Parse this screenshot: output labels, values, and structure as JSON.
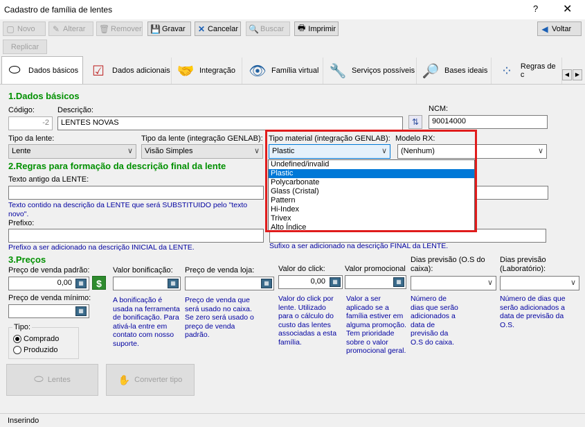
{
  "window": {
    "title": "Cadastro de família de lentes",
    "help": "?",
    "close": "✕"
  },
  "toolbar": {
    "novo": "Novo",
    "alterar": "Alterar",
    "remover": "Remover",
    "gravar": "Gravar",
    "cancelar": "Cancelar",
    "buscar": "Buscar",
    "imprimir": "Imprimir",
    "voltar": "Voltar",
    "replicar": "Replicar"
  },
  "tabs": [
    "Dados básicos",
    "Dados adicionais",
    "Integração",
    "Família virtual",
    "Serviços possíveis",
    "Bases ideais",
    "Regras de c"
  ],
  "sec1": {
    "title": "1.Dados básicos",
    "codigo_label": "Código:",
    "codigo_value": "-2",
    "descricao_label": "Descrição:",
    "descricao_value": "LENTES NOVAS",
    "ncm_label": "NCM:",
    "ncm_value": "90014000",
    "tipo_lente_label": "Tipo da lente:",
    "tipo_lente_value": "Lente",
    "tipo_lente_int_label": "Tipo da lente (integração GENLAB):",
    "tipo_lente_int_value": "Visão Simples",
    "tipo_material_label": "Tipo material (integração GENLAB):",
    "tipo_material_value": "Plastic",
    "modelo_rx_label": "Modelo RX:",
    "modelo_rx_value": "(Nenhum)",
    "material_options": [
      "Undefined/invalid",
      "Plastic",
      "Polycarbonate",
      "Glass (Cristal)",
      "Pattern",
      "Hi-Index",
      "Trivex",
      "Alto Índice"
    ],
    "material_selected_index": 1
  },
  "sec2": {
    "title": "2.Regras para formação da descrição final da lente",
    "texto_antigo_label": "Texto antigo da LENTE:",
    "texto_antigo_hint": "Texto contido na descrição da LENTE que será SUBSTITUIDO pelo \"texto novo\".",
    "prefixo_label": "Prefixo:",
    "prefixo_hint": "Prefixo a ser adicionado na descrição INICIAL da LENTE.",
    "sufixo_hint": "Sufixo a ser adicionado na descrição FINAL da LENTE."
  },
  "sec3": {
    "title": "3.Preços",
    "preco_venda_label": "Preço de venda padrão:",
    "preco_venda_value": "0,00",
    "valor_bonif_label": "Valor bonificação:",
    "valor_bonif_hint": "A bonificação é usada na ferramenta de bonificação. Para ativá-la entre em contato com nosso suporte.",
    "preco_loja_label": "Preço de venda loja:",
    "preco_loja_hint": "Preço de venda que será usado no caixa. Se zero será usado o preço de venda padrão.",
    "valor_click_label": "Valor do click:",
    "valor_click_value": "0,00",
    "valor_click_hint": "Valor do click por lente. Utilizado para o cálculo do custo das lentes associadas a esta família.",
    "valor_promo_label": "Valor promocional",
    "valor_promo_hint": "Valor a ser aplicado se a família estiver em alguma promoção. Tem prioridade sobre o valor promocional geral.",
    "dias_caixa_label": "Dias previsão (O.S do caixa):",
    "dias_caixa_hint": "Número de dias que serão adicionados a data de previsão da O.S do caixa.",
    "dias_lab_label": "Dias previsão (Laboratório):",
    "dias_lab_hint": "Número de dias que serão adicionados a data de previsão da O.S.",
    "preco_min_label": "Preço de venda mínimo:",
    "tipo_label": "Tipo:",
    "comprado": "Comprado",
    "produzido": "Produzido"
  },
  "buttons": {
    "lentes": "Lentes",
    "converter": "Converter tipo"
  },
  "status": "Inserindo",
  "colors": {
    "section": "#009000",
    "hint": "#0000a0",
    "highlight": "#0078d7",
    "redbox": "#e01c1c"
  }
}
